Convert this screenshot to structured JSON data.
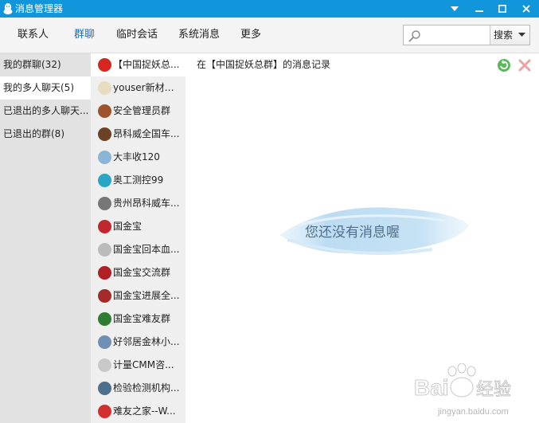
{
  "window": {
    "title": "消息管理器",
    "icons": {
      "logo": "qq-penguin-icon",
      "menu": "dropdown-arrow-icon",
      "minimize": "minimize-icon",
      "maximize": "maximize-icon",
      "close": "close-icon"
    }
  },
  "toolbar": {
    "tabs": [
      {
        "label": "联系人",
        "active": false
      },
      {
        "label": "群聊",
        "active": true
      },
      {
        "label": "临时会话",
        "active": false
      },
      {
        "label": "系统消息",
        "active": false
      },
      {
        "label": "更多",
        "active": false
      }
    ],
    "search": {
      "placeholder": "",
      "value": "",
      "button_label": "搜索",
      "icon": "search-icon"
    }
  },
  "categories": [
    {
      "label": "我的群聊(32)",
      "selected": false
    },
    {
      "label": "我的多人聊天(5)",
      "selected": true
    },
    {
      "label": "已退出的多人聊天...",
      "selected": false
    },
    {
      "label": "已退出的群(8)",
      "selected": false
    }
  ],
  "groups": [
    {
      "name": "【中国捉妖总...",
      "selected": true,
      "avatar_color": "#d7261e"
    },
    {
      "name": "youser新材料...",
      "selected": false,
      "avatar_color": "#c9a45a"
    },
    {
      "name": "安全管理员群",
      "selected": false,
      "avatar_color": "#a0522d"
    },
    {
      "name": "昂科威全国车...",
      "selected": false,
      "avatar_color": "#6b4226"
    },
    {
      "name": "大丰收120",
      "selected": false,
      "avatar_color": "#8ab4d8"
    },
    {
      "name": "奥工测控99",
      "selected": false,
      "avatar_color": "#2aa6c4"
    },
    {
      "name": "贵州昂科威车...",
      "selected": false,
      "avatar_color": "#777777"
    },
    {
      "name": "国金宝",
      "selected": false,
      "avatar_color": "#c0282d"
    },
    {
      "name": "国金宝回本血...",
      "selected": false,
      "avatar_color": "#bbbbbb"
    },
    {
      "name": "国金宝交流群",
      "selected": false,
      "avatar_color": "#b01f24"
    },
    {
      "name": "国金宝进展全...",
      "selected": false,
      "avatar_color": "#a52a2a"
    },
    {
      "name": "国金宝难友群",
      "selected": false,
      "avatar_color": "#2e7d32"
    },
    {
      "name": "好邻居金林小...",
      "selected": false,
      "avatar_color": "#6f8fb5"
    },
    {
      "name": "计量CMM咨...",
      "selected": false,
      "avatar_color": "#c8c8c8"
    },
    {
      "name": "检验检测机构...",
      "selected": false,
      "avatar_color": "#4e6e8e"
    },
    {
      "name": "难友之家--W...",
      "selected": false,
      "avatar_color": "#d32f2f"
    }
  ],
  "main": {
    "record_title": "在【中国捉妖总群】的消息记录",
    "empty_text": "您还没有消息喔",
    "icons": {
      "refresh": "refresh-icon",
      "delete": "delete-icon"
    }
  },
  "watermark": {
    "brand": "Bai",
    "brand2": "经验",
    "domain": "jingyan.baidu.com",
    "icon": "paw-icon"
  },
  "colors": {
    "titlebar": "#1296db",
    "active_tab": "#1a6fc4",
    "category_bg": "#e2e2e2",
    "group_bg": "#efefef"
  }
}
